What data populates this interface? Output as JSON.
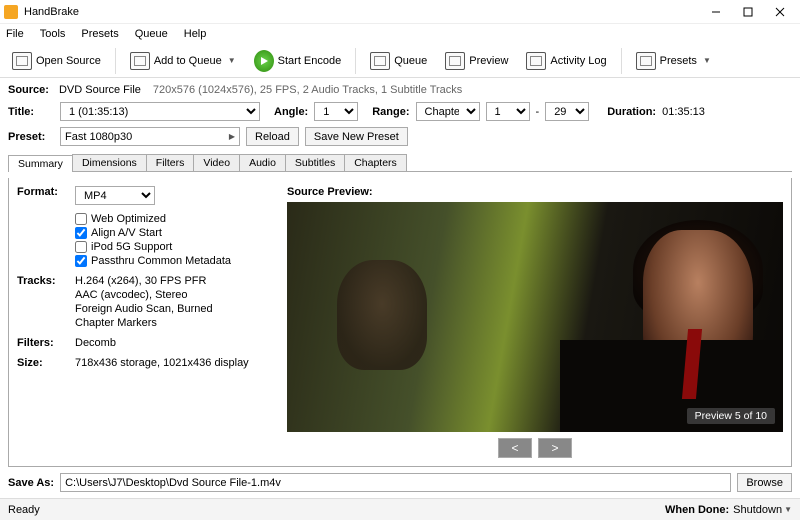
{
  "app": {
    "title": "HandBrake"
  },
  "menu": [
    "File",
    "Tools",
    "Presets",
    "Queue",
    "Help"
  ],
  "toolbar": {
    "open": "Open Source",
    "add_queue": "Add to Queue",
    "start": "Start Encode",
    "queue": "Queue",
    "preview": "Preview",
    "activity": "Activity Log",
    "presets": "Presets"
  },
  "source": {
    "label": "Source:",
    "name": "DVD Source File",
    "details": "720x576 (1024x576), 25 FPS, 2 Audio Tracks, 1 Subtitle Tracks"
  },
  "title": {
    "label": "Title:",
    "value": "1  (01:35:13)",
    "angle_label": "Angle:",
    "angle": "1",
    "range_label": "Range:",
    "range_type": "Chapters",
    "range_start": "1",
    "range_end": "29",
    "dash": "-",
    "duration_label": "Duration:",
    "duration": "01:35:13"
  },
  "preset": {
    "label": "Preset:",
    "value": "Fast 1080p30",
    "reload": "Reload",
    "save_new": "Save New Preset"
  },
  "tabs": [
    "Summary",
    "Dimensions",
    "Filters",
    "Video",
    "Audio",
    "Subtitles",
    "Chapters"
  ],
  "summary": {
    "format_label": "Format:",
    "format": "MP4",
    "checks": [
      {
        "label": "Web Optimized",
        "checked": false
      },
      {
        "label": "Align A/V Start",
        "checked": true
      },
      {
        "label": "iPod 5G Support",
        "checked": false
      },
      {
        "label": "Passthru Common Metadata",
        "checked": true
      }
    ],
    "tracks_label": "Tracks:",
    "tracks": [
      "H.264 (x264), 30 FPS PFR",
      "AAC (avcodec), Stereo",
      "Foreign Audio Scan, Burned",
      "Chapter Markers"
    ],
    "filters_label": "Filters:",
    "filters": "Decomb",
    "size_label": "Size:",
    "size": "718x436 storage, 1021x436 display",
    "preview_label": "Source Preview:",
    "preview_counter": "Preview 5 of 10",
    "nav_prev": "<",
    "nav_next": ">"
  },
  "saveas": {
    "label": "Save As:",
    "value": "C:\\Users\\J7\\Desktop\\Dvd Source File-1.m4v",
    "browse": "Browse"
  },
  "status": {
    "left": "Ready",
    "when_done_label": "When Done:",
    "when_done": "Shutdown"
  }
}
